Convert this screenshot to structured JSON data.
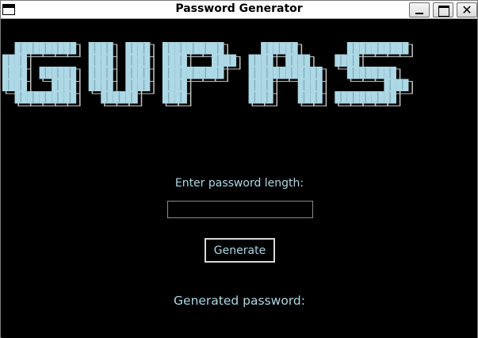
{
  "window": {
    "title": "Password Generator",
    "controls": {
      "minimize": "minimize",
      "maximize": "maximize",
      "close": "✕"
    }
  },
  "banner": {
    "text": "GUPAS",
    "fill_color": "#add8e6",
    "outline_color": "#c0c0c0"
  },
  "form": {
    "length_label": "Enter password length:",
    "length_value": "",
    "generate_label": "Generate",
    "result_label": "Generated password:"
  },
  "colors": {
    "background": "#000000",
    "accent": "#add8e6",
    "button_border": "#d8d8d8"
  }
}
